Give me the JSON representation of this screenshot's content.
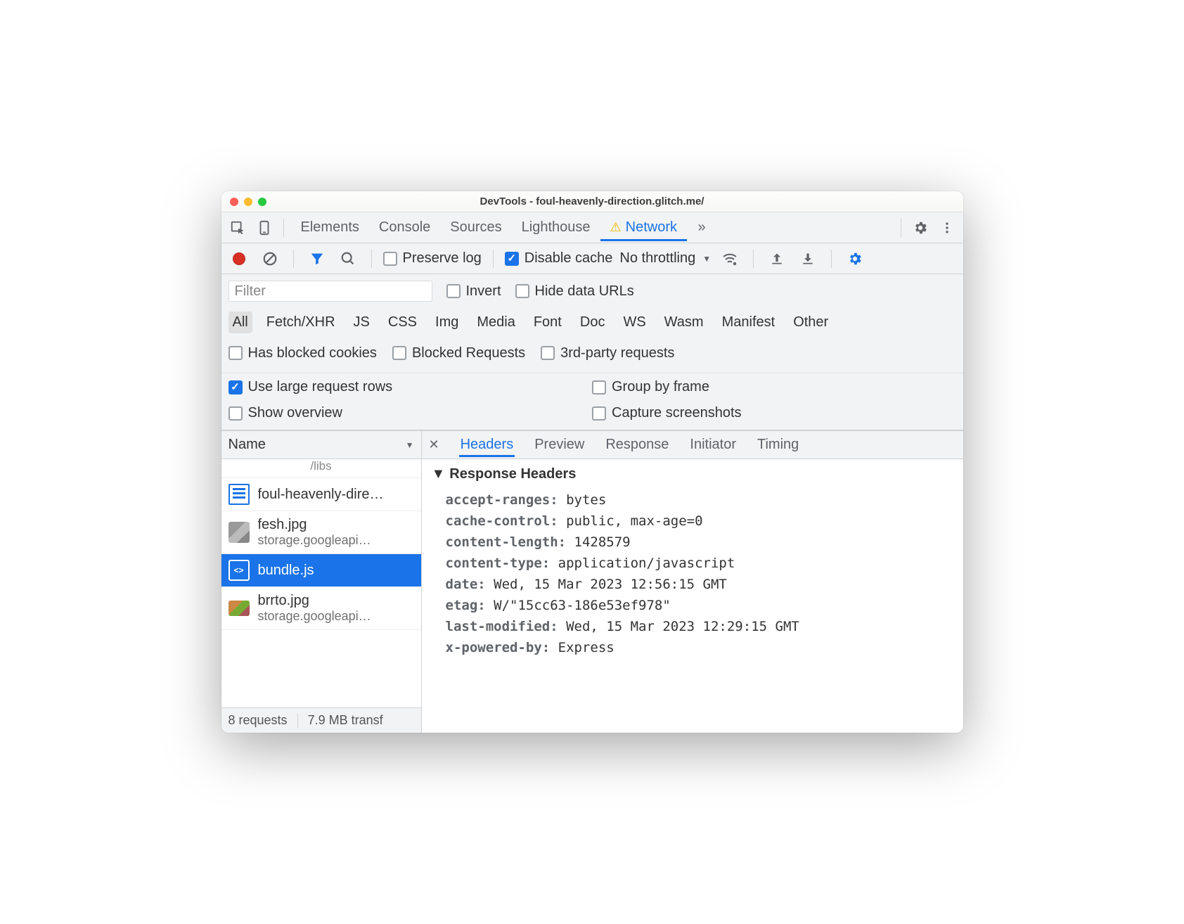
{
  "window_title": "DevTools - foul-heavenly-direction.glitch.me/",
  "main_tabs": [
    "Elements",
    "Console",
    "Sources",
    "Lighthouse",
    "Network"
  ],
  "active_main_tab": "Network",
  "toolbar": {
    "preserve_log": "Preserve log",
    "disable_cache": "Disable cache",
    "throttling": "No throttling"
  },
  "filter": {
    "placeholder": "Filter",
    "invert": "Invert",
    "hide_data_urls": "Hide data URLs",
    "types": [
      "All",
      "Fetch/XHR",
      "JS",
      "CSS",
      "Img",
      "Media",
      "Font",
      "Doc",
      "WS",
      "Wasm",
      "Manifest",
      "Other"
    ],
    "active_type": "All",
    "has_blocked_cookies": "Has blocked cookies",
    "blocked_requests": "Blocked Requests",
    "third_party": "3rd-party requests"
  },
  "settings": {
    "use_large_rows": "Use large request rows",
    "group_by_frame": "Group by frame",
    "show_overview": "Show overview",
    "capture_screenshots": "Capture screenshots"
  },
  "name_column": "Name",
  "requests_prev": "/libs",
  "requests": [
    {
      "name": "foul-heavenly-dire…",
      "sub": "",
      "kind": "doc"
    },
    {
      "name": "fesh.jpg",
      "sub": "storage.googleapi…",
      "kind": "img"
    },
    {
      "name": "bundle.js",
      "sub": "",
      "kind": "js",
      "selected": true
    },
    {
      "name": "brrto.jpg",
      "sub": "storage.googleapi…",
      "kind": "img2"
    }
  ],
  "status": {
    "requests": "8 requests",
    "transfer": "7.9 MB transf"
  },
  "detail_tabs": [
    "Headers",
    "Preview",
    "Response",
    "Initiator",
    "Timing"
  ],
  "active_detail_tab": "Headers",
  "section_title": "Response Headers",
  "response_headers": [
    {
      "k": "accept-ranges:",
      "v": "bytes"
    },
    {
      "k": "cache-control:",
      "v": "public, max-age=0"
    },
    {
      "k": "content-length:",
      "v": "1428579"
    },
    {
      "k": "content-type:",
      "v": "application/javascript"
    },
    {
      "k": "date:",
      "v": "Wed, 15 Mar 2023 12:56:15 GMT"
    },
    {
      "k": "etag:",
      "v": "W/\"15cc63-186e53ef978\""
    },
    {
      "k": "last-modified:",
      "v": "Wed, 15 Mar 2023 12:29:15 GMT"
    },
    {
      "k": "x-powered-by:",
      "v": "Express"
    }
  ]
}
